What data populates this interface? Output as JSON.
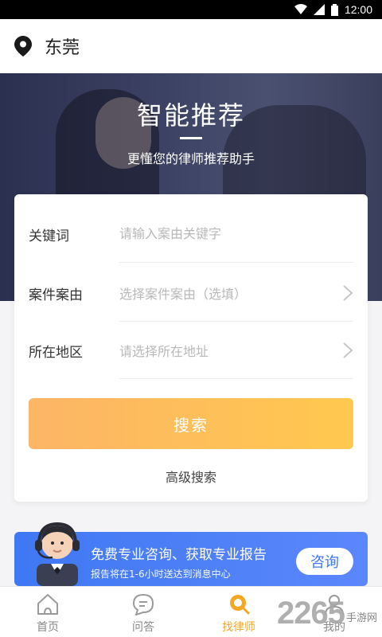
{
  "status_bar": {
    "time": "12:00"
  },
  "location": {
    "city": "东莞"
  },
  "hero": {
    "title": "智能推荐",
    "subtitle": "更懂您的律师推荐助手"
  },
  "form": {
    "keyword": {
      "label": "关键词",
      "placeholder": "请输入案由关键字"
    },
    "case_type": {
      "label": "案件案由",
      "placeholder": "选择案件案由（选填）"
    },
    "region": {
      "label": "所在地区",
      "placeholder": "请选择所在地址"
    },
    "search_label": "搜索",
    "advanced_label": "高级搜索"
  },
  "banner": {
    "title": "免费专业咨询、获取专业报告",
    "subtitle": "报告将在1-6小时送达到消息中心",
    "button_label": "咨询"
  },
  "tabs": [
    {
      "label": "首页",
      "icon": "home-icon"
    },
    {
      "label": "问答",
      "icon": "qa-icon"
    },
    {
      "label": "找律师",
      "icon": "search-icon",
      "active": true
    },
    {
      "label": "我的",
      "icon": "user-icon"
    }
  ],
  "watermark": {
    "number": "2265",
    "text": "手游网"
  },
  "colors": {
    "accent": "#f5a623",
    "button_start": "#fdb566",
    "button_end": "#ffc84e",
    "banner": "#4a80f6"
  }
}
